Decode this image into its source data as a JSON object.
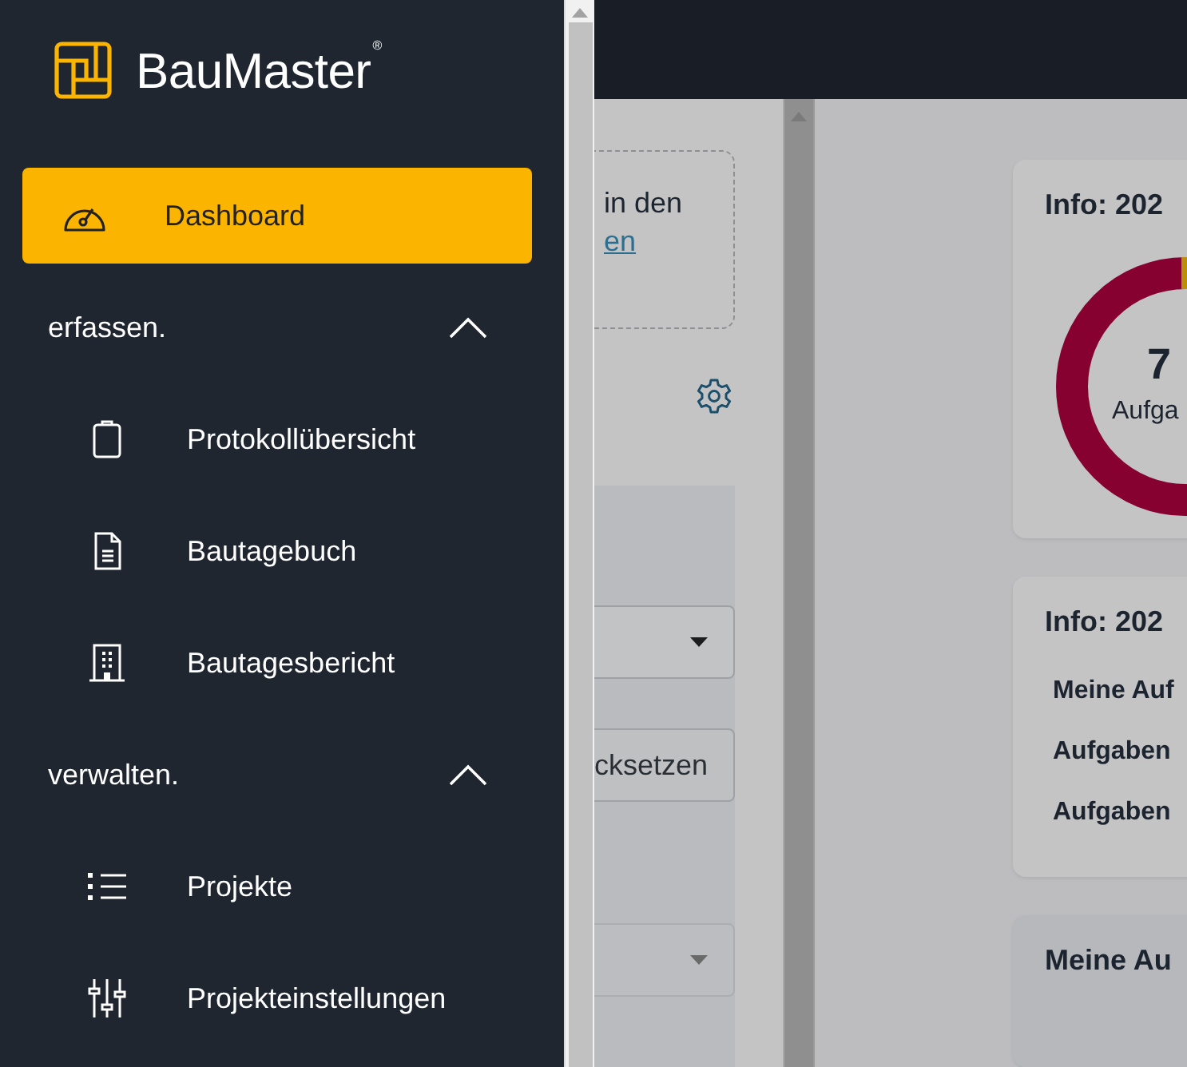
{
  "sidebar": {
    "logo": {
      "name": "BauMaster",
      "mark": "®"
    },
    "items": [
      {
        "kind": "link",
        "label": "Dashboard",
        "selected": true
      },
      {
        "kind": "section",
        "label": "erfassen.",
        "expanded": true,
        "children": [
          {
            "label": "Protokollübersicht",
            "selected": false
          },
          {
            "label": "Bautagebuch",
            "selected": false
          },
          {
            "label": "Bautagesbericht",
            "selected": false
          }
        ]
      },
      {
        "kind": "section",
        "label": "verwalten.",
        "expanded": true,
        "children": [
          {
            "label": "Projekte",
            "selected": false
          },
          {
            "label": "Projekteinstellungen",
            "selected": false
          }
        ]
      }
    ]
  },
  "filter_panel": {
    "hint": "in den",
    "hint_link": "en",
    "reset_button": "cksetzen"
  },
  "cards": [
    {
      "kind": "donut",
      "title": "Info: 202",
      "total": "7",
      "total_label": "Aufga"
    },
    {
      "kind": "list",
      "title": "Info: 202",
      "rows": [
        "Meine Auf",
        "Aufgaben",
        "Aufgaben"
      ]
    },
    {
      "kind": "plain",
      "title": "Meine Au"
    }
  ]
}
